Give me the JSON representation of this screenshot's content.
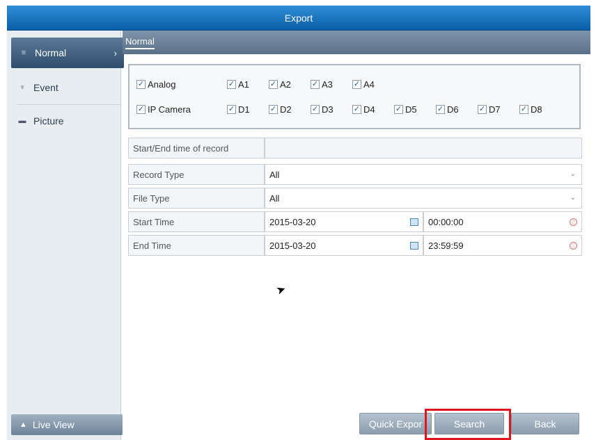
{
  "window": {
    "title": "Export"
  },
  "sidebar": {
    "items": [
      {
        "label": "Normal",
        "icon": "list-icon",
        "active": true
      },
      {
        "label": "Event",
        "icon": "pin-icon",
        "active": false
      },
      {
        "label": "Picture",
        "icon": "picture-icon",
        "active": false
      }
    ],
    "live_view": {
      "label": "Live View",
      "icon": "home-icon"
    }
  },
  "tab": {
    "label": "Normal"
  },
  "channels": {
    "analog": {
      "label": "Analog",
      "checked": true,
      "items": [
        "A1",
        "A2",
        "A3",
        "A4"
      ]
    },
    "ip": {
      "label": "IP Camera",
      "checked": true,
      "items": [
        "D1",
        "D2",
        "D3",
        "D4",
        "D5",
        "D6",
        "D7",
        "D8"
      ]
    }
  },
  "form": {
    "record_time_label": "Start/End time of record",
    "record_type": {
      "label": "Record Type",
      "value": "All"
    },
    "file_type": {
      "label": "File Type",
      "value": "All"
    },
    "start_time": {
      "label": "Start Time",
      "date": "2015-03-20",
      "time": "00:00:00"
    },
    "end_time": {
      "label": "End Time",
      "date": "2015-03-20",
      "time": "23:59:59"
    }
  },
  "buttons": {
    "quick_export": "Quick Expor",
    "search": "Search",
    "back": "Back"
  },
  "colors": {
    "highlight": "#e0141e",
    "titlebar": "#0a5ea8"
  }
}
